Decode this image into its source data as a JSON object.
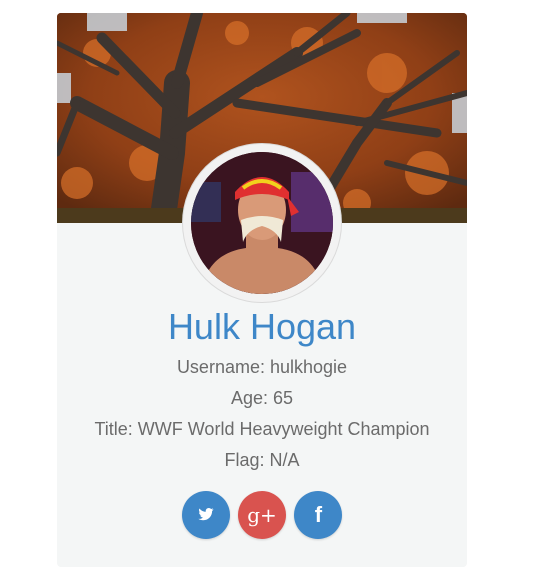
{
  "profile": {
    "name": "Hulk Hogan",
    "username_label": "Username:",
    "username": "hulkhogie",
    "age_label": "Age:",
    "age": "65",
    "title_label": "Title:",
    "title": "WWF World Heavyweight Champion",
    "flag_label": "Flag:",
    "flag": "N/A"
  },
  "socials": [
    {
      "name": "twitter",
      "icon": "twitter-icon",
      "color": "#3e87c8"
    },
    {
      "name": "google-plus",
      "icon": "google-plus-icon",
      "color": "#d9534f",
      "glyph": "g+"
    },
    {
      "name": "facebook",
      "icon": "facebook-icon",
      "color": "#3e87c8",
      "glyph": "f"
    }
  ],
  "colors": {
    "name": "#3e87c8",
    "text": "#6b6b6b",
    "card_background": "#f4f6f6"
  }
}
